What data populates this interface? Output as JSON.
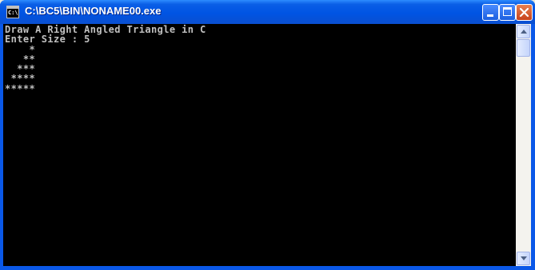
{
  "window": {
    "title": "C:\\BC5\\BIN\\NONAME00.exe",
    "icon": "console-app-icon",
    "icon_text": "C:\\"
  },
  "titlebar_buttons": {
    "minimize": "minimize-icon",
    "maximize": "maximize-icon",
    "close": "close-icon"
  },
  "console": {
    "lines": [
      "Draw A Right Angled Triangle in C",
      "Enter Size : 5",
      "    *",
      "   **",
      "  ***",
      " ****",
      "*****"
    ]
  },
  "colors": {
    "titlebar": "#0054e3",
    "console_bg": "#000000",
    "console_text": "#c0c0c0",
    "close_button": "#c7421c"
  }
}
